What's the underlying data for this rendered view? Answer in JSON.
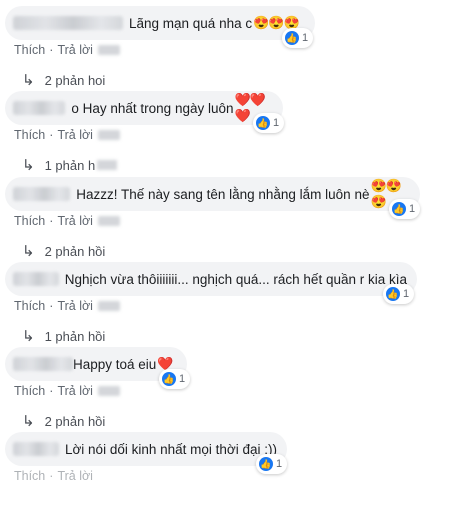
{
  "actions": {
    "like": "Thích",
    "reply": "Trả lời",
    "sep": "·"
  },
  "comments": [
    {
      "text": "Lãng mạn quá nha c",
      "emoji": "😍😍😍",
      "reactions": "1",
      "replies": "2 phản hoi"
    },
    {
      "text": "o Hay nhất trong ngày luôn",
      "emoji": "❤️❤️❤️",
      "reactions": "1",
      "replies": "1 phản h"
    },
    {
      "text": "Hazzz! Thế này sang tên lằng nhằng lắm luôn nè",
      "emoji": "😍😍😍",
      "reactions": "1",
      "replies": "2 phản hồi"
    },
    {
      "text": "Nghịch vừa thôiiiiiii... nghịch quá... rách hết quần r kia kìa",
      "emoji": "",
      "reactions": "1",
      "replies": "1 phản hồi"
    },
    {
      "text": "Happy toá eiu",
      "emoji": "❤️",
      "reactions": "1",
      "replies": "2 phản hồi"
    },
    {
      "text": "Lời nói dối kinh nhất mọi thời đại :))",
      "emoji": "",
      "reactions": "1",
      "replies": ""
    }
  ],
  "icons": {
    "like": "thumbs-up-icon",
    "reply_arrow": "reply-arrow-icon"
  },
  "colors": {
    "bubble": "#f2f3f5",
    "like_blue": "#1877f2",
    "meta_gray": "#606770"
  }
}
